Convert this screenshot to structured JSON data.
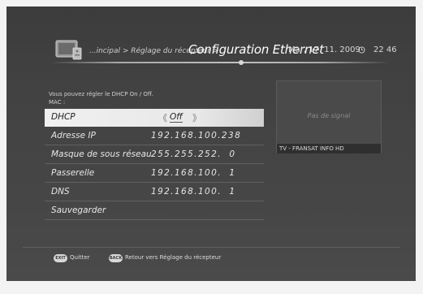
{
  "header": {
    "breadcrumb": "...incipal > Réglage du récepteur >",
    "title": "Configuration Ethernet",
    "date": "Mar, 17. 11. 2009",
    "time": "22 46"
  },
  "info": {
    "line1": "Vous pouvez régler le DHCP On / Off.",
    "line2": "MAC :"
  },
  "settings": [
    {
      "label": "DHCP",
      "value": "Off"
    },
    {
      "label": "Adresse IP",
      "value": "192.168.100.238"
    },
    {
      "label": "Masque de sous réseau",
      "value": "255.255.252.  0"
    },
    {
      "label": "Passerelle",
      "value": "192.168.100.  1"
    },
    {
      "label": "DNS",
      "value": "192.168.100.  1"
    },
    {
      "label": "Sauvegarder",
      "value": ""
    }
  ],
  "preview": {
    "no_signal": "Pas de signal",
    "channel": "TV - FRANSAT INFO HD"
  },
  "footer": {
    "exit_key": "EXIT",
    "exit_label": "Quitter",
    "back_key": "BACK",
    "back_label": "Retour vers Réglage du récepteur"
  },
  "icons": {
    "header": "tv-settings-icon",
    "clock": "clock-icon",
    "arrow_left": "chevron-left-icon",
    "arrow_right": "chevron-right-icon"
  },
  "colors": {
    "background": "#424242",
    "highlight": "#e8e8e8",
    "text": "#e6e6e6"
  }
}
